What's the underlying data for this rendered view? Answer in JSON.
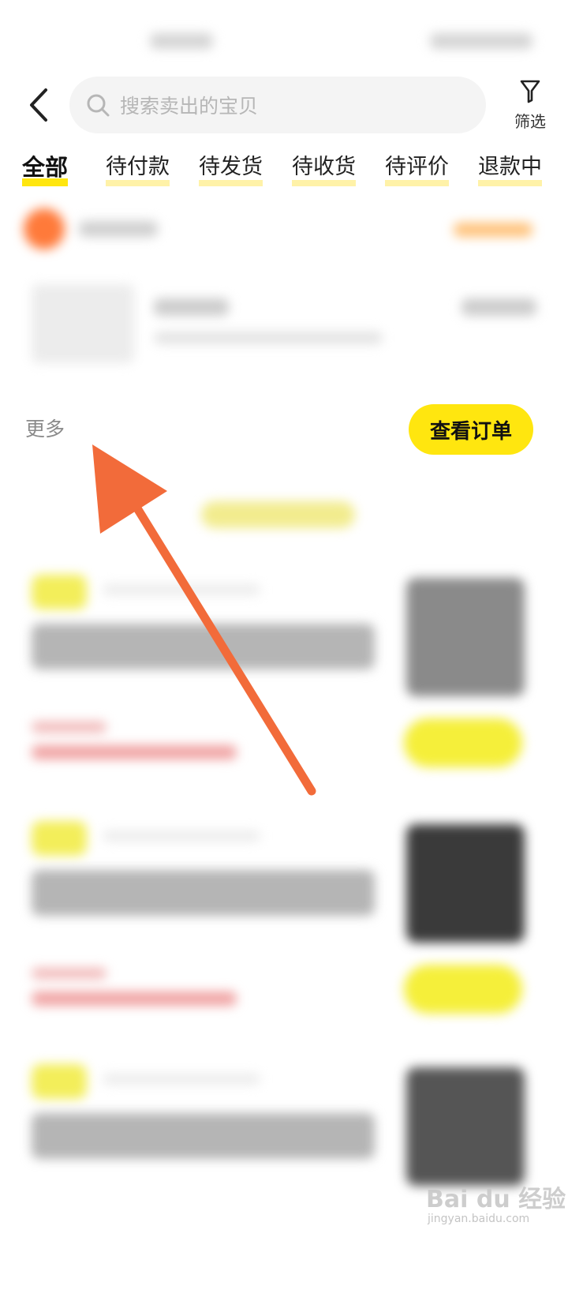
{
  "header": {
    "search_placeholder": "搜索卖出的宝贝",
    "filter_label": "筛选"
  },
  "tabs": [
    {
      "label": "全部",
      "active": true
    },
    {
      "label": "待付款"
    },
    {
      "label": "待发货"
    },
    {
      "label": "待收货"
    },
    {
      "label": "待评价"
    },
    {
      "label": "退款中"
    }
  ],
  "order": {
    "more_label": "更多",
    "view_order_label": "查看订单"
  },
  "icons": {
    "back": "chevron-left-icon",
    "search": "search-icon",
    "filter": "filter-icon"
  },
  "colors": {
    "accent": "#ffe60f",
    "annotation_arrow": "#f26b3a"
  },
  "watermark": {
    "main": "Bai du 经验",
    "sub": "jingyan.baidu.com"
  }
}
